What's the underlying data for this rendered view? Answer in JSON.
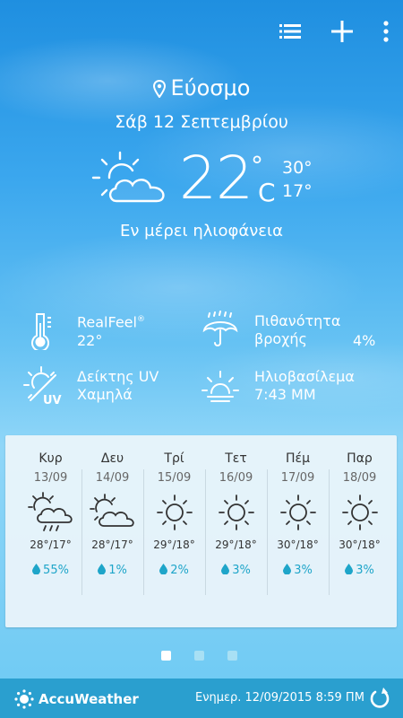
{
  "toolbar": {
    "list_icon": "list-icon",
    "add_icon": "plus-icon",
    "menu_icon": "more-vert-icon"
  },
  "location": {
    "name": "Εύοσμο",
    "icon": "location-pin-icon"
  },
  "date": "Σάβ 12 Σεπτεμβρίου",
  "current": {
    "temp": "22",
    "degree": "°",
    "unit": "C",
    "high": "30°",
    "low": "17°",
    "condition": "Εν μέρει ηλιοφάνεια",
    "icon": "partly-sunny-icon"
  },
  "details": {
    "realfeel_label": "RealFeel",
    "realfeel_mark": "®",
    "realfeel_value": "22°",
    "rain_label_1": "Πιθανότητα",
    "rain_label_2": "βροχής",
    "rain_value": "4%",
    "uv_label": "Δείκτης UV",
    "uv_value": "Χαμηλά",
    "sunset_label": "Ηλιοβασίλεμα",
    "sunset_value": "7:43 ΜΜ"
  },
  "forecast": [
    {
      "day": "Κυρ",
      "date": "13/09",
      "temps": "28°/17°",
      "rain": "55%",
      "icon": "sun-cloud-rain-icon"
    },
    {
      "day": "Δευ",
      "date": "14/09",
      "temps": "28°/17°",
      "rain": "1%",
      "icon": "partly-sunny-icon"
    },
    {
      "day": "Τρί",
      "date": "15/09",
      "temps": "29°/18°",
      "rain": "2%",
      "icon": "sun-icon"
    },
    {
      "day": "Τετ",
      "date": "16/09",
      "temps": "29°/18°",
      "rain": "3%",
      "icon": "sun-icon"
    },
    {
      "day": "Πέμ",
      "date": "17/09",
      "temps": "30°/18°",
      "rain": "3%",
      "icon": "sun-icon"
    },
    {
      "day": "Παρ",
      "date": "18/09",
      "temps": "30°/18°",
      "rain": "3%",
      "icon": "sun-icon"
    }
  ],
  "pager": {
    "pages": 3,
    "active": 1
  },
  "footer": {
    "brand": "AccuWeather",
    "updated": "Ενημερ. 12/09/2015 8:59 ΠΜ"
  },
  "colors": {
    "accent": "#1ea5c9",
    "footer": "#2a9fcf"
  }
}
